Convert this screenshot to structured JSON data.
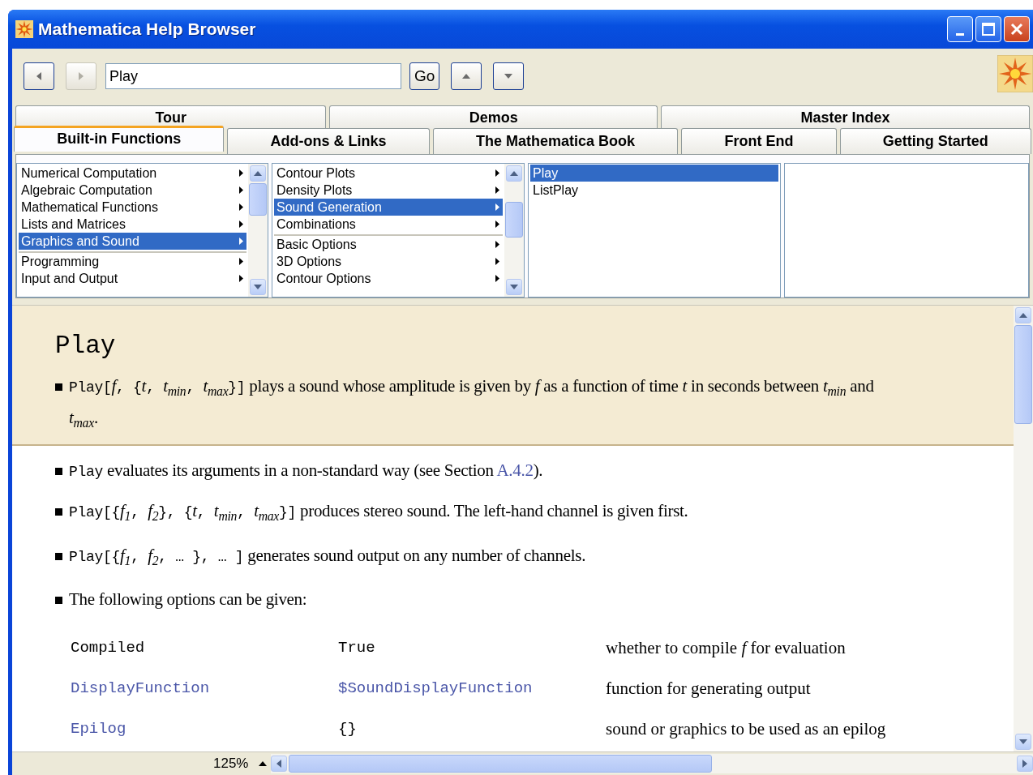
{
  "window": {
    "title": "Mathematica Help Browser"
  },
  "toolbar": {
    "search": {
      "value": "Play"
    },
    "go_button": "Go"
  },
  "tab_rows": [
    [
      {
        "label": "Tour",
        "selected": false
      },
      {
        "label": "Demos",
        "selected": false
      },
      {
        "label": "Master Index",
        "selected": false
      }
    ],
    [
      {
        "label": "Built-in Functions",
        "selected": true
      },
      {
        "label": "Add-ons & Links",
        "selected": false
      },
      {
        "label": "The Mathematica Book",
        "selected": false
      },
      {
        "label": "Front End",
        "selected": false
      },
      {
        "label": "Getting Started",
        "selected": false
      }
    ]
  ],
  "browser_columns": [
    {
      "scrollable": true,
      "items": [
        {
          "label": "Numerical Computation",
          "selected": false,
          "divider_above": false,
          "submenu": true
        },
        {
          "label": "Algebraic Computation",
          "selected": false,
          "divider_above": false,
          "submenu": true
        },
        {
          "label": "Mathematical Functions",
          "selected": false,
          "divider_above": false,
          "submenu": true
        },
        {
          "label": "Lists and Matrices",
          "selected": false,
          "divider_above": false,
          "submenu": true
        },
        {
          "label": "Graphics and Sound",
          "selected": true,
          "divider_above": false,
          "submenu": true
        },
        {
          "label": "Programming",
          "selected": false,
          "divider_above": true,
          "submenu": true
        },
        {
          "label": "Input and Output",
          "selected": false,
          "divider_above": false,
          "submenu": true
        }
      ]
    },
    {
      "scrollable": true,
      "items": [
        {
          "label": "Contour Plots",
          "selected": false,
          "divider_above": false,
          "submenu": true
        },
        {
          "label": "Density Plots",
          "selected": false,
          "divider_above": false,
          "submenu": true
        },
        {
          "label": "Sound Generation",
          "selected": true,
          "divider_above": false,
          "submenu": true
        },
        {
          "label": "Combinations",
          "selected": false,
          "divider_above": false,
          "submenu": true
        },
        {
          "label": "Basic Options",
          "selected": false,
          "divider_above": true,
          "submenu": true
        },
        {
          "label": "3D Options",
          "selected": false,
          "divider_above": false,
          "submenu": true
        },
        {
          "label": "Contour Options",
          "selected": false,
          "divider_above": false,
          "submenu": true
        }
      ]
    },
    {
      "scrollable": false,
      "items": [
        {
          "label": "Play",
          "selected": true,
          "divider_above": false,
          "submenu": false
        },
        {
          "label": "ListPlay",
          "selected": false,
          "divider_above": false,
          "submenu": false
        }
      ]
    },
    {
      "scrollable": false
    }
  ],
  "document": {
    "title": "Play",
    "summary": [
      {
        "kind": "code",
        "text": "Play["
      },
      {
        "kind": "math",
        "text": "f"
      },
      {
        "kind": "code",
        "text": ", {"
      },
      {
        "kind": "math",
        "text": "t"
      },
      {
        "kind": "code",
        "text": ", "
      },
      {
        "kind": "math",
        "text": "t$_{min}$"
      },
      {
        "kind": "code",
        "text": ", "
      },
      {
        "kind": "math",
        "text": "t$_{max}$"
      },
      {
        "kind": "code",
        "text": "}]"
      },
      {
        "kind": "text",
        "text": " plays a sound whose amplitude is given by "
      },
      {
        "kind": "math",
        "text": "f"
      },
      {
        "kind": "text",
        "text": " as a function of time "
      },
      {
        "kind": "math",
        "text": "t"
      },
      {
        "kind": "text",
        "text": " in seconds between "
      },
      {
        "kind": "math",
        "text": "t$_{min}$"
      },
      {
        "kind": "text",
        "text": " and "
      },
      {
        "kind": "math",
        "text": "t$_{max}$"
      },
      {
        "kind": "text",
        "text": "."
      }
    ],
    "notes": [
      [
        {
          "kind": "code",
          "text": "Play"
        },
        {
          "kind": "text",
          "text": " evaluates its arguments in a non-standard way (see Section "
        },
        {
          "kind": "link",
          "text": "A.4.2"
        },
        {
          "kind": "text",
          "text": ")."
        }
      ],
      [
        {
          "kind": "code",
          "text": "Play[{"
        },
        {
          "kind": "math",
          "text": "f$_{1}$"
        },
        {
          "kind": "code",
          "text": ", "
        },
        {
          "kind": "math",
          "text": "f$_{2}$"
        },
        {
          "kind": "code",
          "text": "}, {"
        },
        {
          "kind": "math",
          "text": "t"
        },
        {
          "kind": "code",
          "text": ", "
        },
        {
          "kind": "math",
          "text": "t$_{min}$"
        },
        {
          "kind": "code",
          "text": ", "
        },
        {
          "kind": "math",
          "text": "t$_{max}$"
        },
        {
          "kind": "code",
          "text": "}]"
        },
        {
          "kind": "text",
          "text": " produces stereo sound. The left-hand channel is given first."
        }
      ],
      [
        {
          "kind": "code",
          "text": "Play[{"
        },
        {
          "kind": "math",
          "text": "f$_{1}$"
        },
        {
          "kind": "code",
          "text": ", "
        },
        {
          "kind": "math",
          "text": "f$_{2}$"
        },
        {
          "kind": "code",
          "text": ", … }, … ]"
        },
        {
          "kind": "text",
          "text": " generates sound output on any number of channels."
        }
      ],
      [
        {
          "kind": "text",
          "text": "The following options can be given:"
        }
      ]
    ],
    "options": [
      [
        {
          "text": "Compiled",
          "link": false
        },
        {
          "text": "True",
          "link": false
        },
        {
          "text": "whether to compile *f* for evaluation",
          "link": false
        }
      ],
      [
        {
          "text": "DisplayFunction",
          "link": true
        },
        {
          "text": "$SoundDisplayFunction",
          "link": true
        },
        {
          "text": "function for generating output",
          "link": false
        }
      ],
      [
        {
          "text": "Epilog",
          "link": true
        },
        {
          "text": "{}",
          "link": false
        },
        {
          "text": "sound or graphics to be used as an epilog",
          "link": false
        }
      ]
    ]
  },
  "status_bar": {
    "zoom": "125%"
  }
}
